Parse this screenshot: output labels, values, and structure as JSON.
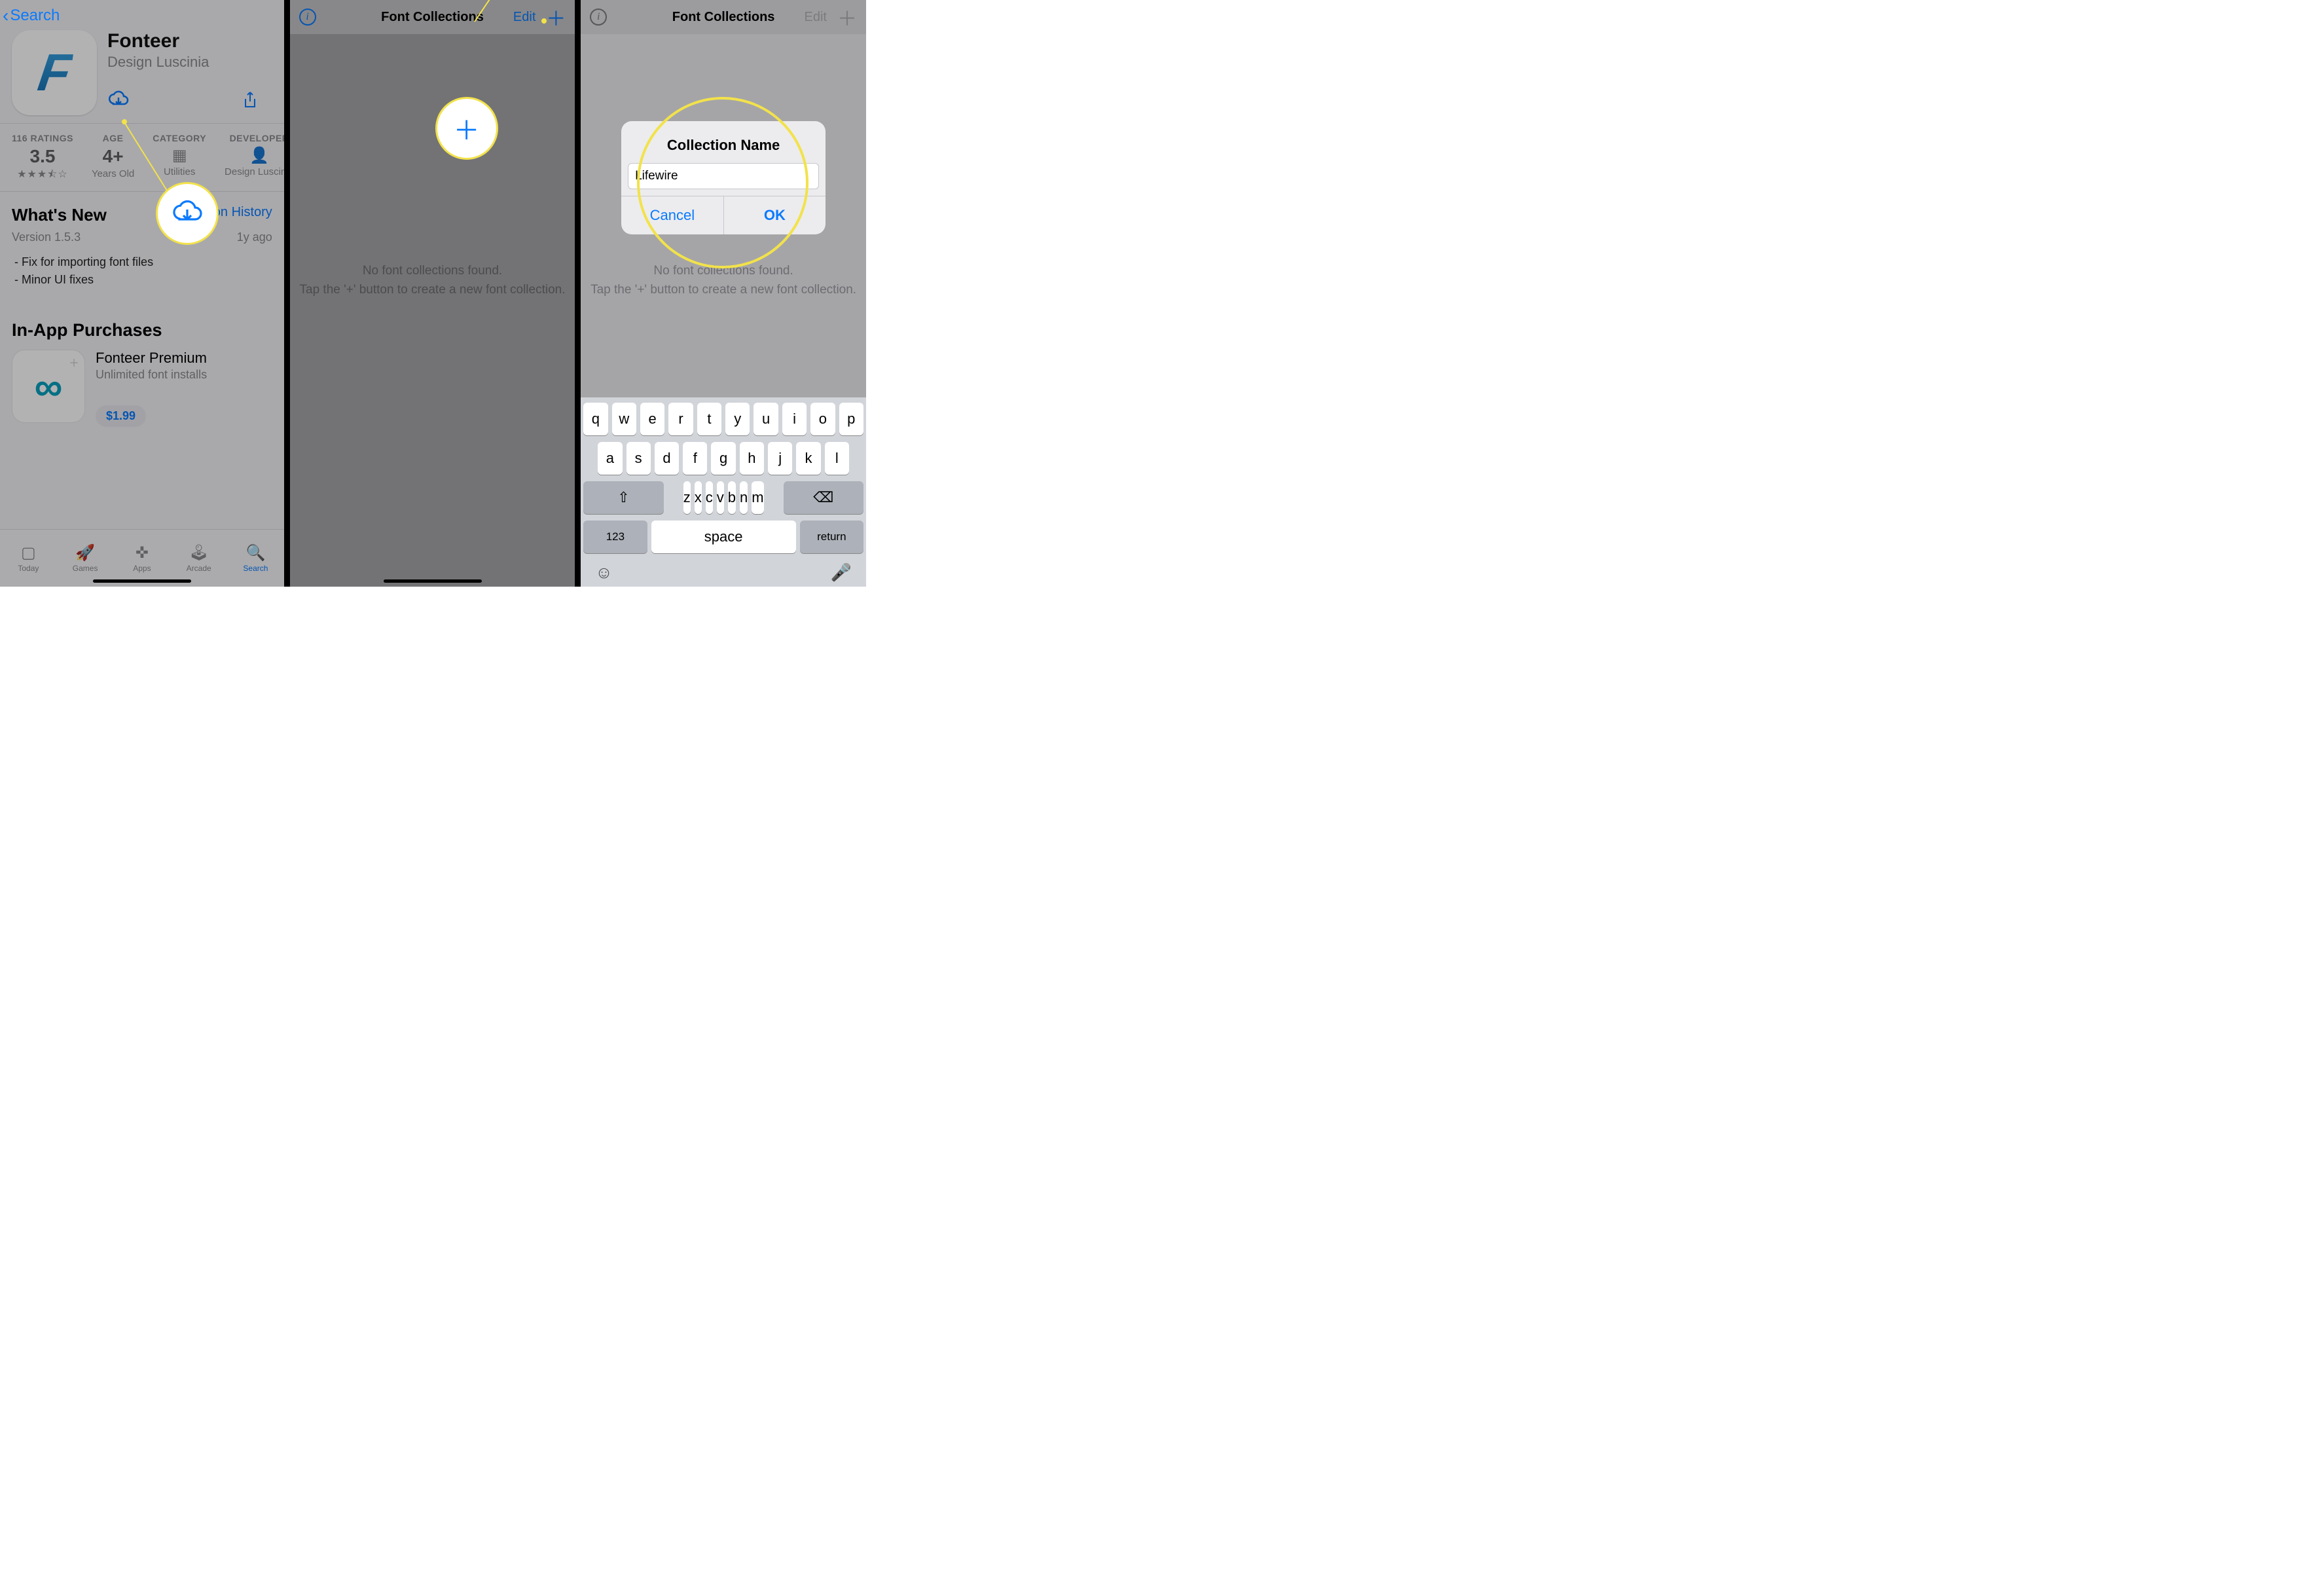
{
  "panel1": {
    "back_label": "Search",
    "app": {
      "name": "Fonteer",
      "developer": "Design Luscinia",
      "icon_letter": "F"
    },
    "metrics": {
      "ratings_label": "116 RATINGS",
      "ratings_value": "3.5",
      "ratings_stars": "★★★⯪☆",
      "age_label": "AGE",
      "age_value": "4+",
      "age_sub": "Years Old",
      "category_label": "CATEGORY",
      "category_sub": "Utilities",
      "dev_label": "DEVELOPER",
      "dev_sub": "Design Luscinia"
    },
    "whatsnew": {
      "title": "What's New",
      "version_history": "Version History",
      "version": "Version 1.5.3",
      "age": "1y ago",
      "note1": "- Fix for importing font files",
      "note2": "- Minor UI fixes"
    },
    "iap": {
      "section": "In-App Purchases",
      "name": "Fonteer Premium",
      "desc": "Unlimited font installs",
      "price": "$1.99"
    },
    "tabs": {
      "today": "Today",
      "games": "Games",
      "apps": "Apps",
      "arcade": "Arcade",
      "search": "Search"
    }
  },
  "panel2": {
    "title": "Font Collections",
    "edit": "Edit",
    "empty1": "No font collections found.",
    "empty2": "Tap the '+' button to create a new font collection."
  },
  "panel3": {
    "title": "Font Collections",
    "edit": "Edit",
    "empty1": "No font collections found.",
    "empty2": "Tap the '+' button to create a new font collection.",
    "alert": {
      "title": "Collection Name",
      "value": "Lifewire",
      "cancel": "Cancel",
      "ok": "OK"
    },
    "kbd": {
      "r1": [
        "q",
        "w",
        "e",
        "r",
        "t",
        "y",
        "u",
        "i",
        "o",
        "p"
      ],
      "r2": [
        "a",
        "s",
        "d",
        "f",
        "g",
        "h",
        "j",
        "k",
        "l"
      ],
      "r3": [
        "z",
        "x",
        "c",
        "v",
        "b",
        "n",
        "m"
      ],
      "num": "123",
      "space": "space",
      "return": "return"
    }
  }
}
